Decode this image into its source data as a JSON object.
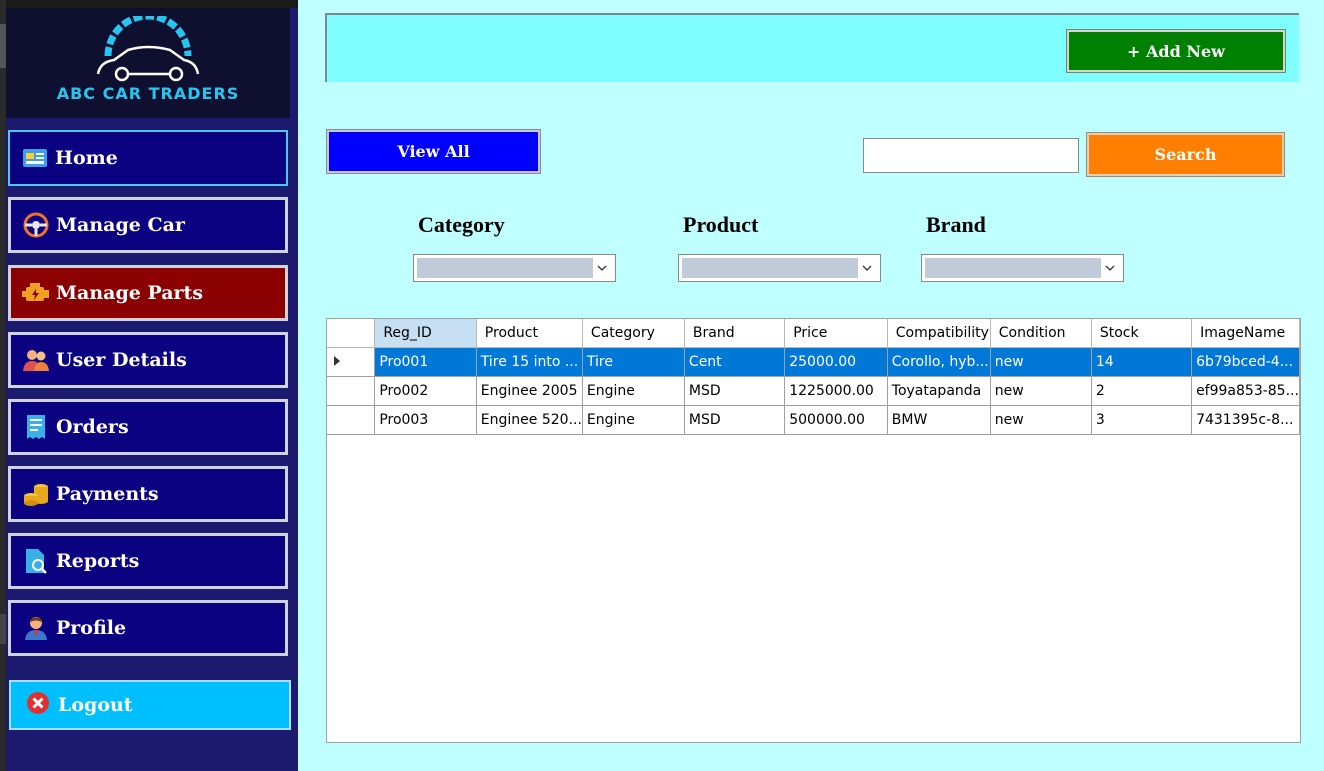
{
  "brand": {
    "name": "ABC CAR TRADERS"
  },
  "sidebar": {
    "items": [
      {
        "label": "Home",
        "icon": "dashboard-icon"
      },
      {
        "label": "Manage Car",
        "icon": "steering-wheel-icon"
      },
      {
        "label": "Manage Parts",
        "icon": "engine-icon",
        "active": true
      },
      {
        "label": "User Details",
        "icon": "users-icon"
      },
      {
        "label": "Orders",
        "icon": "receipt-icon"
      },
      {
        "label": "Payments",
        "icon": "coins-icon"
      },
      {
        "label": "Reports",
        "icon": "report-icon"
      },
      {
        "label": "Profile",
        "icon": "user-icon"
      }
    ],
    "logout": {
      "label": "Logout",
      "icon": "close-circle-icon"
    }
  },
  "toolbar": {
    "add_new_label": "+ Add New"
  },
  "actions": {
    "view_all_label": "View All",
    "search_label": "Search",
    "search_value": ""
  },
  "filters": {
    "category": {
      "label": "Category",
      "value": ""
    },
    "product": {
      "label": "Product",
      "value": ""
    },
    "brand": {
      "label": "Brand",
      "value": ""
    }
  },
  "table": {
    "columns": [
      "Reg_ID",
      "Product",
      "Category",
      "Brand",
      "Price",
      "Compatibility",
      "Condition",
      "Stock",
      "ImageName"
    ],
    "rows": [
      [
        "Pro001",
        "Tire 15 into ...",
        "Tire",
        "Cent",
        "25000.00",
        "Corollo, hyb...",
        "new",
        "14",
        "6b79bced-4..."
      ],
      [
        "Pro002",
        "Enginee 2005",
        "Engine",
        "MSD",
        "1225000.00",
        "Toyatapanda",
        "new",
        "2",
        "ef99a853-85..."
      ],
      [
        "Pro003",
        "Enginee 520...",
        "Engine",
        "MSD",
        "500000.00",
        "BMW",
        "new",
        "3",
        "7431395c-8..."
      ]
    ],
    "selected_row": 0
  },
  "colors": {
    "sidebar_bg": "#1c1a6e",
    "nav_btn": "#0a0280",
    "nav_active": "#8b0000",
    "logout": "#00bfff",
    "add_new": "#008000",
    "view_all": "#0000ff",
    "search": "#ff8000",
    "main_bg": "#c0ffff",
    "topbar": "#7fffff",
    "selection": "#0078d7"
  }
}
